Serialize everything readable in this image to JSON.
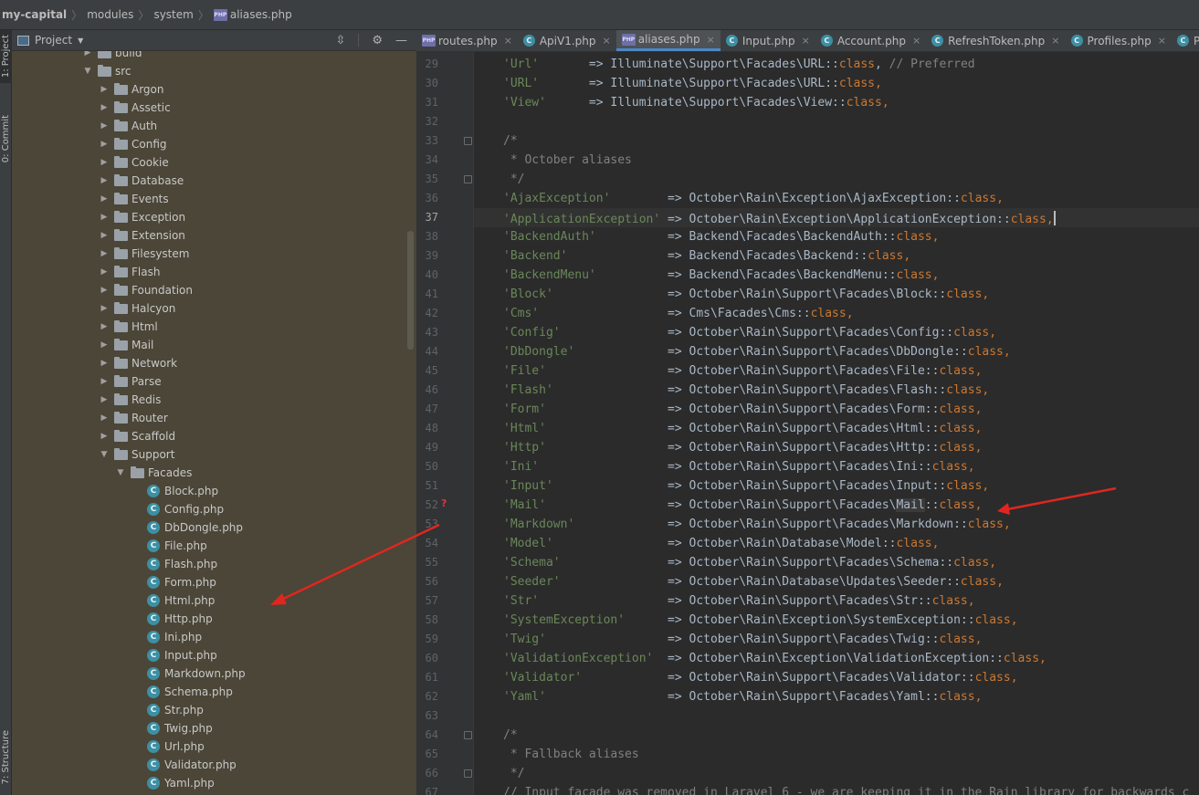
{
  "breadcrumb": {
    "items": [
      "my-capital",
      "modules",
      "system",
      "aliases.php"
    ]
  },
  "side_stripe": {
    "project_label": "1: Project",
    "commit_label": "0: Commit",
    "structure_label": "7: Structure"
  },
  "project_panel": {
    "title": "Project",
    "tree": [
      {
        "label": "build",
        "kind": "folder",
        "depth": 1,
        "expanded": false
      },
      {
        "label": "src",
        "kind": "folder",
        "depth": 1,
        "expanded": true
      },
      {
        "label": "Argon",
        "kind": "folder",
        "depth": 2,
        "expanded": false
      },
      {
        "label": "Assetic",
        "kind": "folder",
        "depth": 2,
        "expanded": false
      },
      {
        "label": "Auth",
        "kind": "folder",
        "depth": 2,
        "expanded": false
      },
      {
        "label": "Config",
        "kind": "folder",
        "depth": 2,
        "expanded": false
      },
      {
        "label": "Cookie",
        "kind": "folder",
        "depth": 2,
        "expanded": false
      },
      {
        "label": "Database",
        "kind": "folder",
        "depth": 2,
        "expanded": false
      },
      {
        "label": "Events",
        "kind": "folder",
        "depth": 2,
        "expanded": false
      },
      {
        "label": "Exception",
        "kind": "folder",
        "depth": 2,
        "expanded": false
      },
      {
        "label": "Extension",
        "kind": "folder",
        "depth": 2,
        "expanded": false
      },
      {
        "label": "Filesystem",
        "kind": "folder",
        "depth": 2,
        "expanded": false
      },
      {
        "label": "Flash",
        "kind": "folder",
        "depth": 2,
        "expanded": false
      },
      {
        "label": "Foundation",
        "kind": "folder",
        "depth": 2,
        "expanded": false
      },
      {
        "label": "Halcyon",
        "kind": "folder",
        "depth": 2,
        "expanded": false
      },
      {
        "label": "Html",
        "kind": "folder",
        "depth": 2,
        "expanded": false
      },
      {
        "label": "Mail",
        "kind": "folder",
        "depth": 2,
        "expanded": false
      },
      {
        "label": "Network",
        "kind": "folder",
        "depth": 2,
        "expanded": false
      },
      {
        "label": "Parse",
        "kind": "folder",
        "depth": 2,
        "expanded": false
      },
      {
        "label": "Redis",
        "kind": "folder",
        "depth": 2,
        "expanded": false
      },
      {
        "label": "Router",
        "kind": "folder",
        "depth": 2,
        "expanded": false
      },
      {
        "label": "Scaffold",
        "kind": "folder",
        "depth": 2,
        "expanded": false
      },
      {
        "label": "Support",
        "kind": "folder",
        "depth": 2,
        "expanded": true
      },
      {
        "label": "Facades",
        "kind": "folder",
        "depth": 3,
        "expanded": true
      },
      {
        "label": "Block.php",
        "kind": "class",
        "depth": 4
      },
      {
        "label": "Config.php",
        "kind": "class",
        "depth": 4
      },
      {
        "label": "DbDongle.php",
        "kind": "class",
        "depth": 4
      },
      {
        "label": "File.php",
        "kind": "class",
        "depth": 4
      },
      {
        "label": "Flash.php",
        "kind": "class",
        "depth": 4
      },
      {
        "label": "Form.php",
        "kind": "class",
        "depth": 4
      },
      {
        "label": "Html.php",
        "kind": "class",
        "depth": 4
      },
      {
        "label": "Http.php",
        "kind": "class",
        "depth": 4
      },
      {
        "label": "Ini.php",
        "kind": "class",
        "depth": 4
      },
      {
        "label": "Input.php",
        "kind": "class",
        "depth": 4
      },
      {
        "label": "Markdown.php",
        "kind": "class",
        "depth": 4
      },
      {
        "label": "Schema.php",
        "kind": "class",
        "depth": 4
      },
      {
        "label": "Str.php",
        "kind": "class",
        "depth": 4
      },
      {
        "label": "Twig.php",
        "kind": "class",
        "depth": 4
      },
      {
        "label": "Url.php",
        "kind": "class",
        "depth": 4
      },
      {
        "label": "Validator.php",
        "kind": "class",
        "depth": 4
      },
      {
        "label": "Yaml.php",
        "kind": "class",
        "depth": 4
      }
    ]
  },
  "tabs": [
    {
      "label": "routes.php",
      "icon": "php",
      "active": false
    },
    {
      "label": "ApiV1.php",
      "icon": "class",
      "active": false
    },
    {
      "label": "aliases.php",
      "icon": "php",
      "active": true
    },
    {
      "label": "Input.php",
      "icon": "class",
      "active": false
    },
    {
      "label": "Account.php",
      "icon": "class",
      "active": false
    },
    {
      "label": "RefreshToken.php",
      "icon": "class",
      "active": false
    },
    {
      "label": "Profiles.php",
      "icon": "class",
      "active": false
    },
    {
      "label": "Project",
      "icon": "class",
      "active": false
    }
  ],
  "editor": {
    "current_line": 37,
    "lines": [
      {
        "n": 29,
        "parts": [
          [
            "s",
            "'Url'"
          ],
          [
            "p",
            "       => Illuminate\\Support\\Facades\\URL::"
          ],
          [
            "k",
            "class"
          ],
          [
            "p",
            ", "
          ],
          [
            "c",
            "// Preferred"
          ]
        ]
      },
      {
        "n": 30,
        "parts": [
          [
            "s",
            "'URL'"
          ],
          [
            "p",
            "       => Illuminate\\Support\\Facades\\URL::"
          ],
          [
            "k",
            "class"
          ],
          [
            "k",
            ","
          ]
        ]
      },
      {
        "n": 31,
        "parts": [
          [
            "s",
            "'View'"
          ],
          [
            "p",
            "      => Illuminate\\Support\\Facades\\View::"
          ],
          [
            "k",
            "class"
          ],
          [
            "k",
            ","
          ]
        ]
      },
      {
        "n": 32,
        "parts": []
      },
      {
        "n": 33,
        "parts": [
          [
            "c",
            "/*"
          ]
        ]
      },
      {
        "n": 34,
        "parts": [
          [
            "c",
            " * October aliases"
          ]
        ]
      },
      {
        "n": 35,
        "parts": [
          [
            "c",
            " */"
          ]
        ]
      },
      {
        "n": 36,
        "parts": [
          [
            "s",
            "'AjaxException'"
          ],
          [
            "p",
            "        => October\\Rain\\Exception\\AjaxException::"
          ],
          [
            "k",
            "class"
          ],
          [
            "k",
            ","
          ]
        ]
      },
      {
        "n": 37,
        "parts": [
          [
            "s",
            "'ApplicationException'"
          ],
          [
            "p",
            " => October\\Rain\\Exception\\ApplicationException::"
          ],
          [
            "k",
            "class"
          ],
          [
            "k",
            ","
          ]
        ]
      },
      {
        "n": 38,
        "parts": [
          [
            "s",
            "'BackendAuth'"
          ],
          [
            "p",
            "          => Backend\\Facades\\BackendAuth::"
          ],
          [
            "k",
            "class"
          ],
          [
            "k",
            ","
          ]
        ]
      },
      {
        "n": 39,
        "parts": [
          [
            "s",
            "'Backend'"
          ],
          [
            "p",
            "              => Backend\\Facades\\Backend::"
          ],
          [
            "k",
            "class"
          ],
          [
            "k",
            ","
          ]
        ]
      },
      {
        "n": 40,
        "parts": [
          [
            "s",
            "'BackendMenu'"
          ],
          [
            "p",
            "          => Backend\\Facades\\BackendMenu::"
          ],
          [
            "k",
            "class"
          ],
          [
            "k",
            ","
          ]
        ]
      },
      {
        "n": 41,
        "parts": [
          [
            "s",
            "'Block'"
          ],
          [
            "p",
            "                => October\\Rain\\Support\\Facades\\Block::"
          ],
          [
            "k",
            "class"
          ],
          [
            "k",
            ","
          ]
        ]
      },
      {
        "n": 42,
        "parts": [
          [
            "s",
            "'Cms'"
          ],
          [
            "p",
            "                  => Cms\\Facades\\Cms::"
          ],
          [
            "k",
            "class"
          ],
          [
            "k",
            ","
          ]
        ]
      },
      {
        "n": 43,
        "parts": [
          [
            "s",
            "'Config'"
          ],
          [
            "p",
            "               => October\\Rain\\Support\\Facades\\Config::"
          ],
          [
            "k",
            "class"
          ],
          [
            "k",
            ","
          ]
        ]
      },
      {
        "n": 44,
        "parts": [
          [
            "s",
            "'DbDongle'"
          ],
          [
            "p",
            "             => October\\Rain\\Support\\Facades\\DbDongle::"
          ],
          [
            "k",
            "class"
          ],
          [
            "k",
            ","
          ]
        ]
      },
      {
        "n": 45,
        "parts": [
          [
            "s",
            "'File'"
          ],
          [
            "p",
            "                 => October\\Rain\\Support\\Facades\\File::"
          ],
          [
            "k",
            "class"
          ],
          [
            "k",
            ","
          ]
        ]
      },
      {
        "n": 46,
        "parts": [
          [
            "s",
            "'Flash'"
          ],
          [
            "p",
            "                => October\\Rain\\Support\\Facades\\Flash::"
          ],
          [
            "k",
            "class"
          ],
          [
            "k",
            ","
          ]
        ]
      },
      {
        "n": 47,
        "parts": [
          [
            "s",
            "'Form'"
          ],
          [
            "p",
            "                 => October\\Rain\\Support\\Facades\\Form::"
          ],
          [
            "k",
            "class"
          ],
          [
            "k",
            ","
          ]
        ]
      },
      {
        "n": 48,
        "parts": [
          [
            "s",
            "'Html'"
          ],
          [
            "p",
            "                 => October\\Rain\\Support\\Facades\\Html::"
          ],
          [
            "k",
            "class"
          ],
          [
            "k",
            ","
          ]
        ]
      },
      {
        "n": 49,
        "parts": [
          [
            "s",
            "'Http'"
          ],
          [
            "p",
            "                 => October\\Rain\\Support\\Facades\\Http::"
          ],
          [
            "k",
            "class"
          ],
          [
            "k",
            ","
          ]
        ]
      },
      {
        "n": 50,
        "parts": [
          [
            "s",
            "'Ini'"
          ],
          [
            "p",
            "                  => October\\Rain\\Support\\Facades\\Ini::"
          ],
          [
            "k",
            "class"
          ],
          [
            "k",
            ","
          ]
        ]
      },
      {
        "n": 51,
        "parts": [
          [
            "s",
            "'Input'"
          ],
          [
            "p",
            "                => October\\Rain\\Support\\Facades\\Input::"
          ],
          [
            "k",
            "class"
          ],
          [
            "k",
            ","
          ]
        ]
      },
      {
        "n": 52,
        "parts": [
          [
            "s",
            "'Mail'"
          ],
          [
            "p",
            "                 => October\\Rain\\Support\\Facades\\"
          ],
          [
            "h",
            "Mail"
          ],
          [
            "p",
            "::"
          ],
          [
            "k",
            "class"
          ],
          [
            "k",
            ","
          ]
        ]
      },
      {
        "n": 53,
        "parts": [
          [
            "s",
            "'Markdown'"
          ],
          [
            "p",
            "             => October\\Rain\\Support\\Facades\\Markdown::"
          ],
          [
            "k",
            "class"
          ],
          [
            "k",
            ","
          ]
        ]
      },
      {
        "n": 54,
        "parts": [
          [
            "s",
            "'Model'"
          ],
          [
            "p",
            "                => October\\Rain\\Database\\Model::"
          ],
          [
            "k",
            "class"
          ],
          [
            "k",
            ","
          ]
        ]
      },
      {
        "n": 55,
        "parts": [
          [
            "s",
            "'Schema'"
          ],
          [
            "p",
            "               => October\\Rain\\Support\\Facades\\Schema::"
          ],
          [
            "k",
            "class"
          ],
          [
            "k",
            ","
          ]
        ]
      },
      {
        "n": 56,
        "parts": [
          [
            "s",
            "'Seeder'"
          ],
          [
            "p",
            "               => October\\Rain\\Database\\Updates\\Seeder::"
          ],
          [
            "k",
            "class"
          ],
          [
            "k",
            ","
          ]
        ]
      },
      {
        "n": 57,
        "parts": [
          [
            "s",
            "'Str'"
          ],
          [
            "p",
            "                  => October\\Rain\\Support\\Facades\\Str::"
          ],
          [
            "k",
            "class"
          ],
          [
            "k",
            ","
          ]
        ]
      },
      {
        "n": 58,
        "parts": [
          [
            "s",
            "'SystemException'"
          ],
          [
            "p",
            "      => October\\Rain\\Exception\\SystemException::"
          ],
          [
            "k",
            "class"
          ],
          [
            "k",
            ","
          ]
        ]
      },
      {
        "n": 59,
        "parts": [
          [
            "s",
            "'Twig'"
          ],
          [
            "p",
            "                 => October\\Rain\\Support\\Facades\\Twig::"
          ],
          [
            "k",
            "class"
          ],
          [
            "k",
            ","
          ]
        ]
      },
      {
        "n": 60,
        "parts": [
          [
            "s",
            "'ValidationException'"
          ],
          [
            "p",
            "  => October\\Rain\\Exception\\ValidationException::"
          ],
          [
            "k",
            "class"
          ],
          [
            "k",
            ","
          ]
        ]
      },
      {
        "n": 61,
        "parts": [
          [
            "s",
            "'Validator'"
          ],
          [
            "p",
            "            => October\\Rain\\Support\\Facades\\Validator::"
          ],
          [
            "k",
            "class"
          ],
          [
            "k",
            ","
          ]
        ]
      },
      {
        "n": 62,
        "parts": [
          [
            "s",
            "'Yaml'"
          ],
          [
            "p",
            "                 => October\\Rain\\Support\\Facades\\Yaml::"
          ],
          [
            "k",
            "class"
          ],
          [
            "k",
            ","
          ]
        ]
      },
      {
        "n": 63,
        "parts": []
      },
      {
        "n": 64,
        "parts": [
          [
            "c",
            "/*"
          ]
        ]
      },
      {
        "n": 65,
        "parts": [
          [
            "c",
            " * Fallback aliases"
          ]
        ]
      },
      {
        "n": 66,
        "parts": [
          [
            "c",
            " */"
          ]
        ]
      },
      {
        "n": 67,
        "parts": [
          [
            "c",
            "// Input facade was removed in Laravel 6 - we are keeping it in the Rain library for backwards c"
          ]
        ]
      }
    ]
  },
  "annotation_marker": "?",
  "colors": {
    "annotation_arrow": "#e0261f",
    "string": "#6a8759",
    "keyword": "#cc7832",
    "comment": "#808080"
  }
}
